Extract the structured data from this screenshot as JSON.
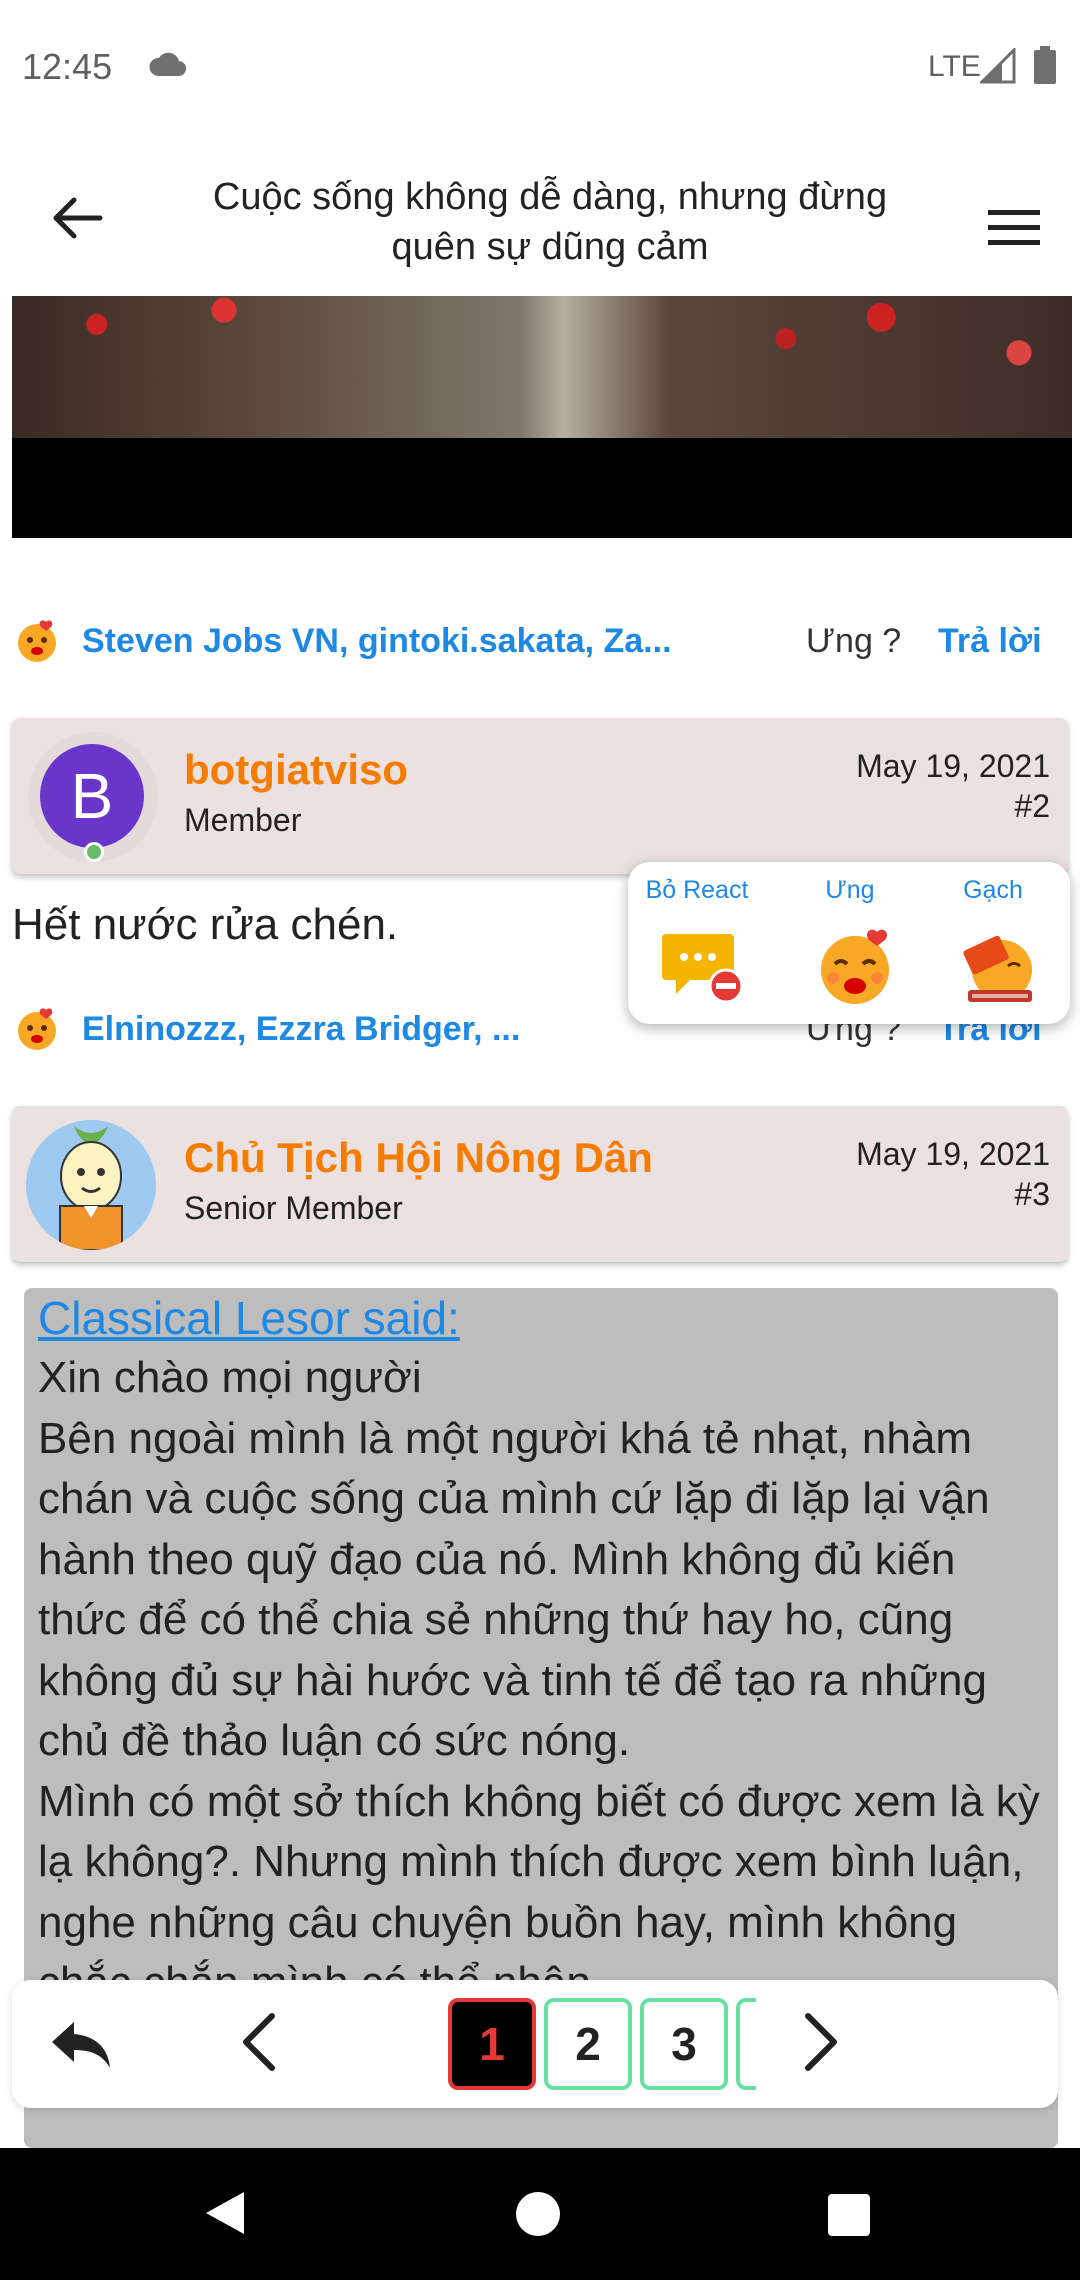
{
  "status_bar": {
    "time": "12:45",
    "network": "LTE"
  },
  "app_bar": {
    "title": "Cuộc sống không dễ dàng, nhưng đừng quên sự dũng cảm"
  },
  "reactions_post1": {
    "names": "Steven Jobs VN, gintoki.sakata, Za...",
    "ung_label": "Ưng ?",
    "reply_label": "Trả lời"
  },
  "post2": {
    "avatar_letter": "B",
    "username": "botgiatviso",
    "role": "Member",
    "date": "May 19, 2021",
    "number": "#2",
    "text": "Hết nước rửa chén."
  },
  "reactions_post2": {
    "names": "Elninozzz, Ezzra Bridger, ...",
    "ung_label": "Ưng ?",
    "reply_label": "Trả lời"
  },
  "react_popup": {
    "items": [
      {
        "label": "Bỏ React",
        "icon": "remove-react-icon"
      },
      {
        "label": "Ưng",
        "icon": "ung-emoji-icon"
      },
      {
        "label": "Gạch",
        "icon": "gach-brick-icon"
      }
    ]
  },
  "post3": {
    "username": "Chủ Tịch Hội Nông Dân",
    "role": "Senior Member",
    "date": "May 19, 2021",
    "number": "#3",
    "quote_author": "Classical Lesor said:",
    "quote_body": "Xin chào mọi người\nBên ngoài mình là một người khá tẻ nhạt, nhàm chán và cuộc sống của mình cứ lặp đi lặp lại vận hành theo quỹ đạo của nó. Mình không đủ kiến thức để có thể chia sẻ những thứ hay ho, cũng không đủ sự hài hước và tinh tế để tạo ra những chủ đề thảo luận có sức nóng.\nMình có một sở thích không biết có được xem là kỳ lạ không?. Nhưng mình thích được xem bình luận, nghe những câu chuyện buồn hay, mình không chắc chắn mình có thể nhận"
  },
  "pager": {
    "pages": [
      "1",
      "2",
      "3"
    ],
    "current": "1"
  },
  "colors": {
    "accent_blue": "#1e88e5",
    "username_orange": "#f57c00",
    "header_bg": "#ebe1e0",
    "quote_bg": "#bdbdbd",
    "active_page": "#e53935"
  }
}
